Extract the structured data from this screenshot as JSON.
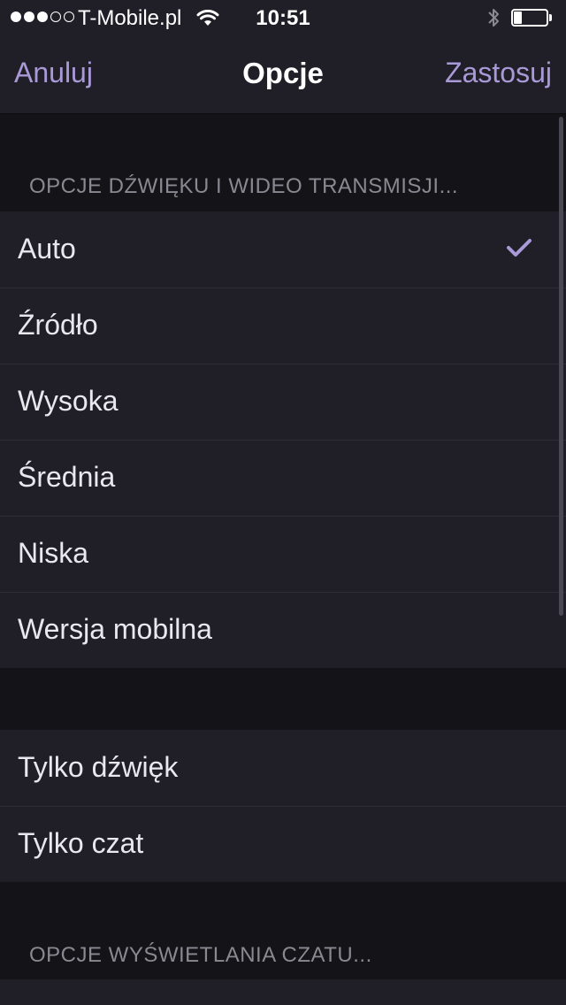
{
  "status_bar": {
    "carrier": "T-Mobile.pl",
    "time": "10:51",
    "signal_strength_dots": 3,
    "signal_total_dots": 5,
    "wifi_icon": "wifi-icon",
    "bluetooth_icon": "bluetooth-icon",
    "battery_level": 0.25
  },
  "nav": {
    "cancel_label": "Anuluj",
    "title": "Opcje",
    "apply_label": "Zastosuj"
  },
  "quality_section": {
    "header": "OPCJE DŹWIĘKU I WIDEO TRANSMISJI...",
    "items": [
      {
        "label": "Auto",
        "selected": true
      },
      {
        "label": "Źródło",
        "selected": false
      },
      {
        "label": "Wysoka",
        "selected": false
      },
      {
        "label": "Średnia",
        "selected": false
      },
      {
        "label": "Niska",
        "selected": false
      },
      {
        "label": "Wersja mobilna",
        "selected": false
      }
    ]
  },
  "extra_section": {
    "items": [
      {
        "label": "Tylko dźwięk"
      },
      {
        "label": "Tylko czat"
      }
    ]
  },
  "chat_section": {
    "header": "OPCJE WYŚWIETLANIA CZATU..."
  },
  "colors": {
    "accent": "#a999d6",
    "background": "#141318",
    "cell_background": "#201f27",
    "section_header_text": "#8a8891"
  }
}
